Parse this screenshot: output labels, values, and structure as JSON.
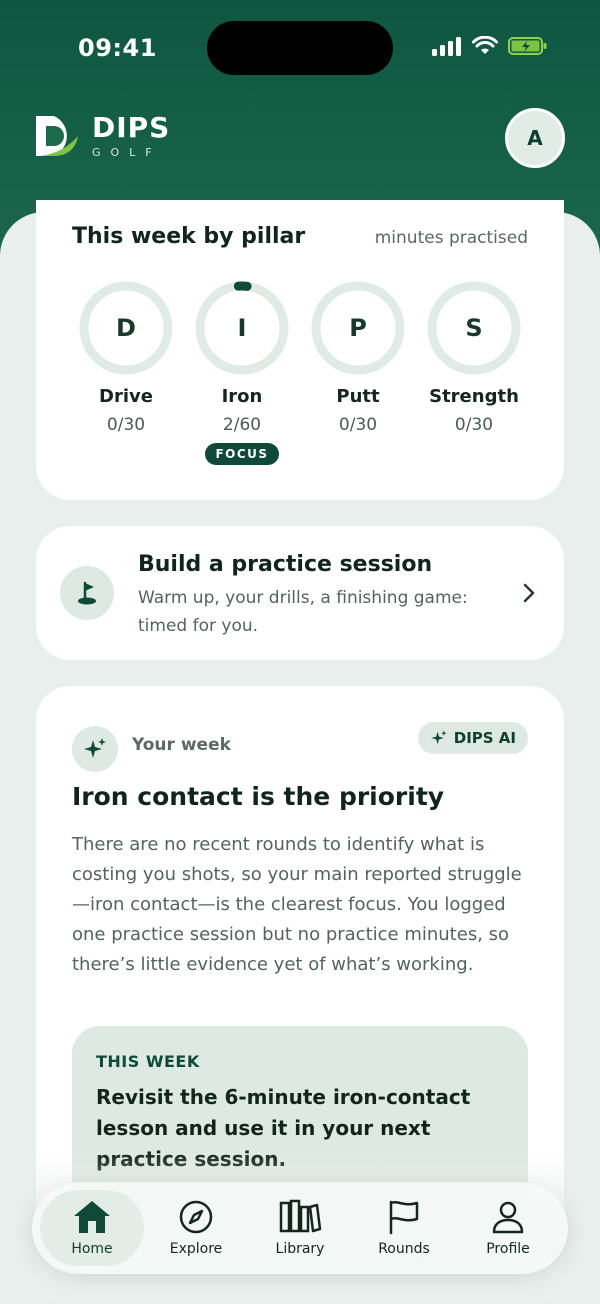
{
  "status_bar": {
    "time": "09:41"
  },
  "brand": {
    "name": "DIPS",
    "sub": "GOLF"
  },
  "user": {
    "avatar_initial": "A"
  },
  "pillars_card": {
    "title": "This week by pillar",
    "subtitle": "minutes practised",
    "items": [
      {
        "letter": "D",
        "name": "Drive",
        "value": "0/30",
        "minutes": 0,
        "target": 30
      },
      {
        "letter": "I",
        "name": "Iron",
        "value": "2/60",
        "minutes": 2,
        "target": 60,
        "badge": "FOCUS"
      },
      {
        "letter": "P",
        "name": "Putt",
        "value": "0/30",
        "minutes": 0,
        "target": 30
      },
      {
        "letter": "S",
        "name": "Strength",
        "value": "0/30",
        "minutes": 0,
        "target": 30
      }
    ]
  },
  "build_session": {
    "title": "Build a practice session",
    "description": "Warm up, your drills, a finishing game: timed for you."
  },
  "your_week": {
    "label": "Your week",
    "badge": "DIPS AI",
    "title": "Iron contact is the priority",
    "body": "There are no recent rounds to identify what is costing you shots, so your main reported struggle—iron contact—is the clearest focus. You logged one practice session but no practice minutes, so there’s little evidence yet of what’s working.",
    "this_week_label": "THIS WEEK",
    "this_week_text": "Revisit the 6-minute iron-contact lesson and use it in your next practice session."
  },
  "tabs": [
    {
      "label": "Home",
      "icon": "home-icon",
      "active": true
    },
    {
      "label": "Explore",
      "icon": "compass-icon",
      "active": false
    },
    {
      "label": "Library",
      "icon": "library-icon",
      "active": false
    },
    {
      "label": "Rounds",
      "icon": "flag-icon",
      "active": false
    },
    {
      "label": "Profile",
      "icon": "profile-icon",
      "active": false
    }
  ],
  "colors": {
    "brand_dark": "#0f4a38",
    "accent_green": "#7cc243",
    "ring_track": "#e1ebe6",
    "ring_progress": "#0f4a38"
  }
}
